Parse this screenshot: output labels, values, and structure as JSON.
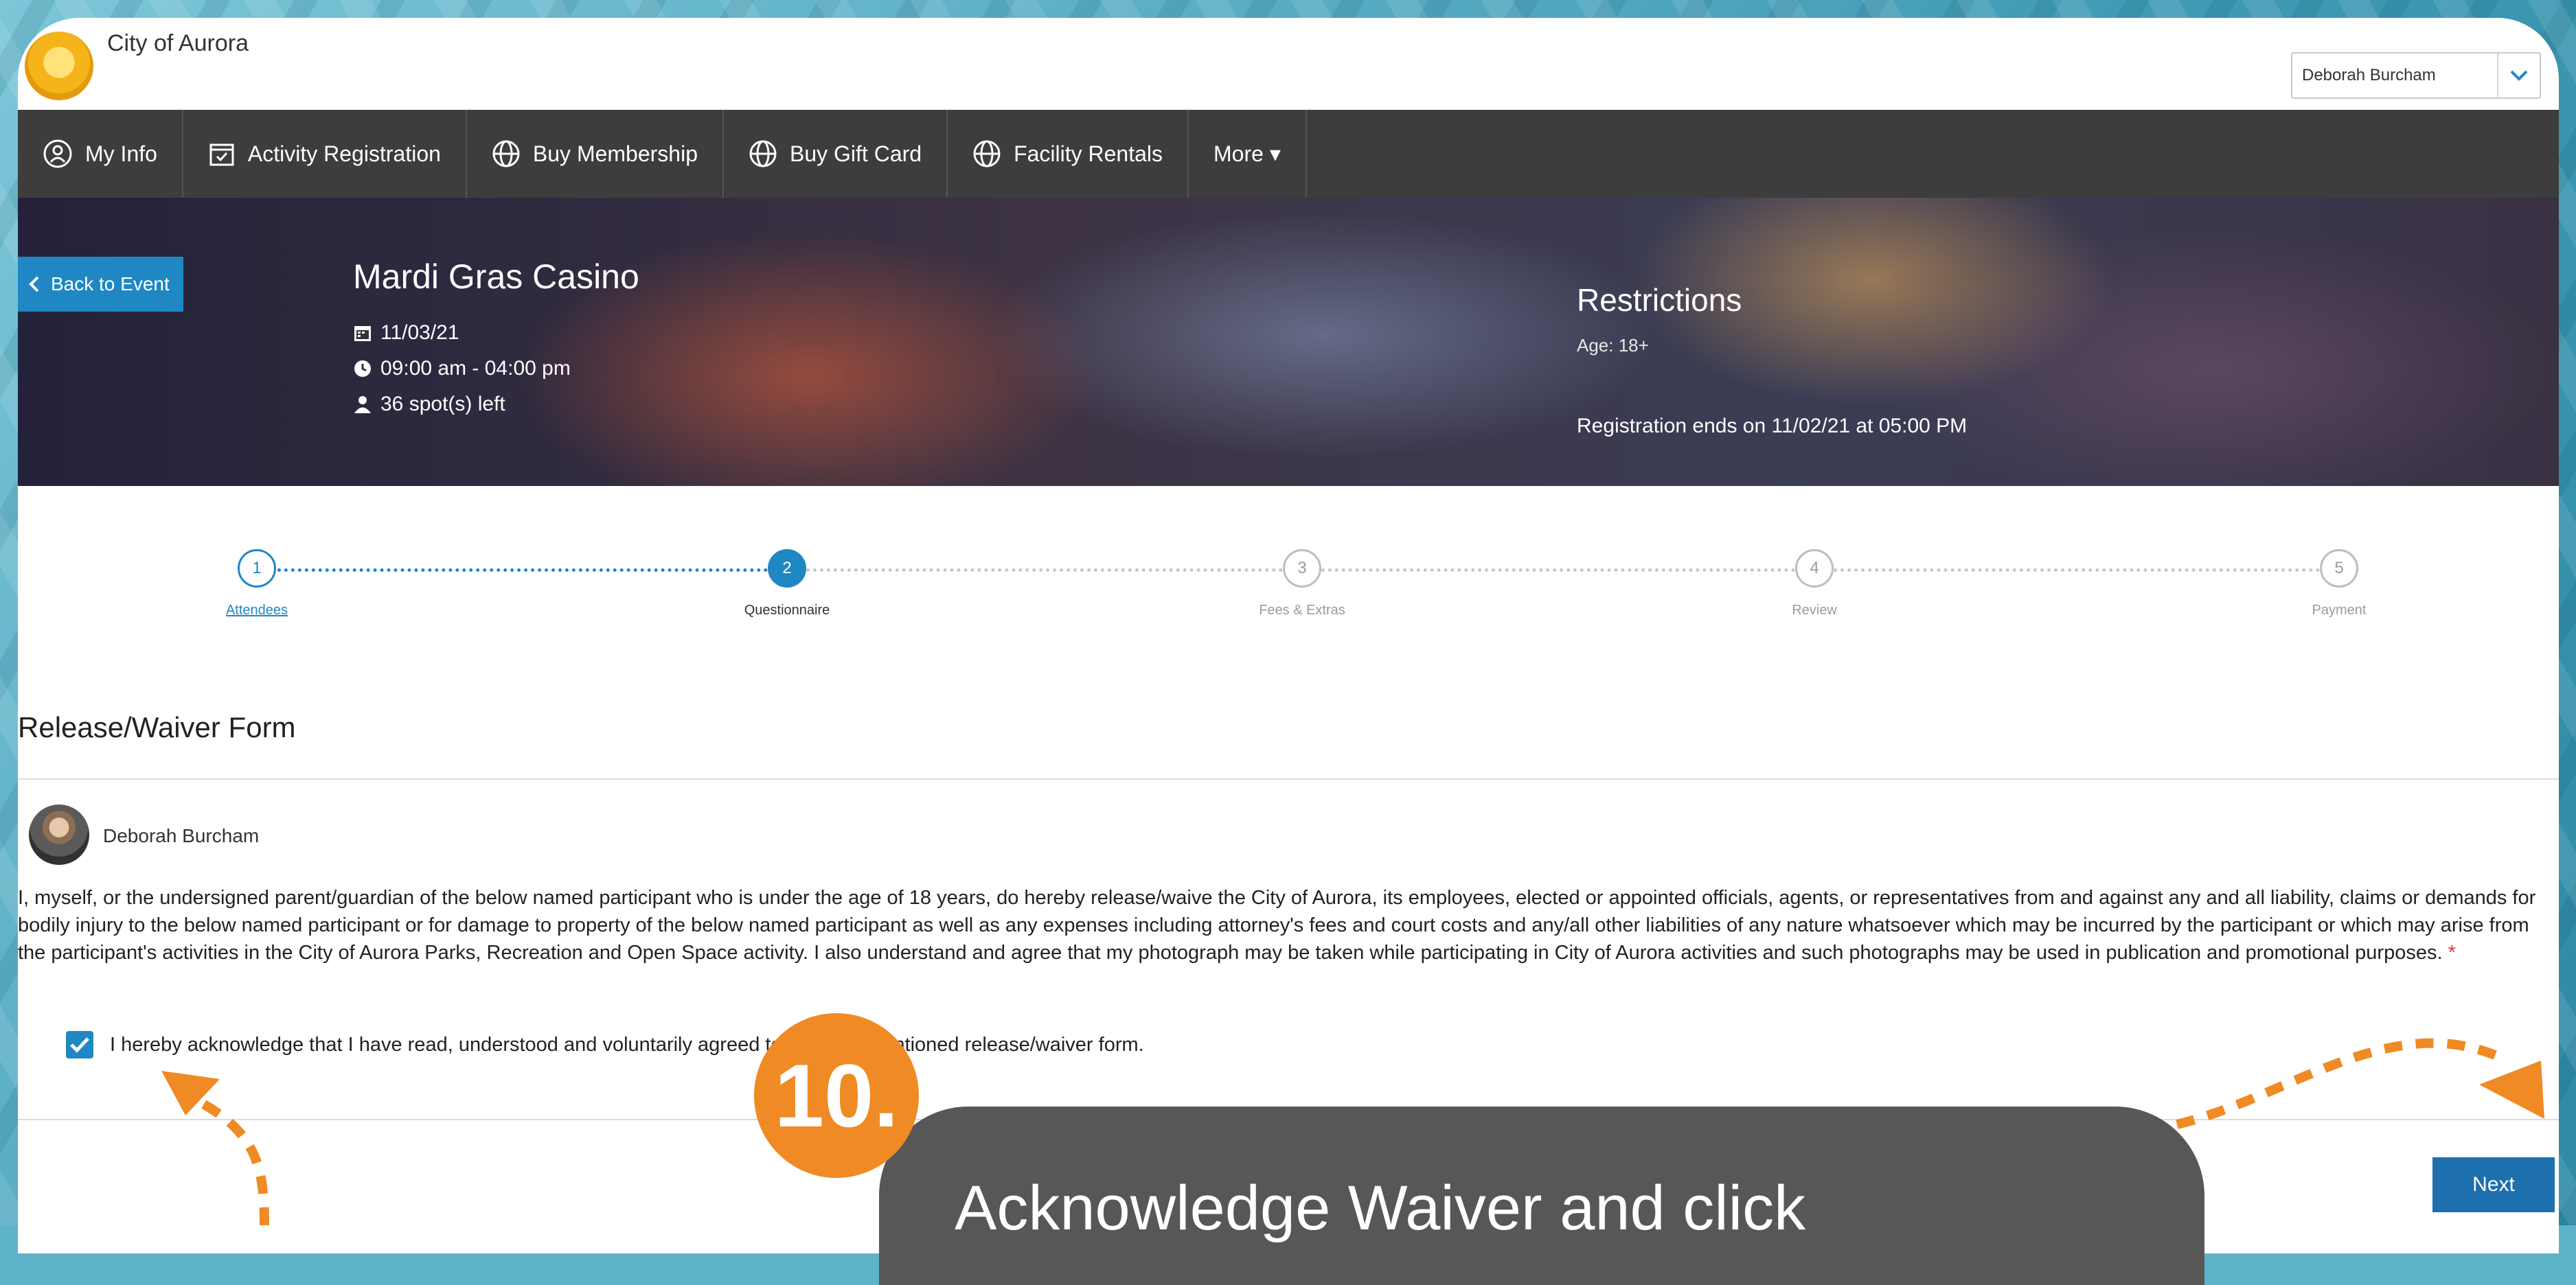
{
  "header": {
    "org_name": "City of Aurora",
    "user_name": "Deborah Burcham"
  },
  "nav": {
    "items": [
      {
        "label": "My Info",
        "icon": "user-circle-icon"
      },
      {
        "label": "Activity Registration",
        "icon": "calendar-check-icon"
      },
      {
        "label": "Buy Membership",
        "icon": "globe-icon"
      },
      {
        "label": "Buy Gift Card",
        "icon": "globe-icon"
      },
      {
        "label": "Facility Rentals",
        "icon": "globe-icon"
      },
      {
        "label": "More ▾",
        "icon": ""
      }
    ]
  },
  "event": {
    "back_label": "Back to Event",
    "title": "Mardi Gras Casino",
    "date": "11/03/21",
    "time": "09:00 am - 04:00 pm",
    "spots": "36 spot(s) left",
    "restrictions_title": "Restrictions",
    "age": "Age: 18+",
    "registration_ends": "Registration ends on 11/02/21 at 05:00 PM"
  },
  "steps": [
    {
      "number": "1",
      "label": "Attendees",
      "state": "done"
    },
    {
      "number": "2",
      "label": "Questionnaire",
      "state": "active"
    },
    {
      "number": "3",
      "label": "Fees & Extras",
      "state": "pending"
    },
    {
      "number": "4",
      "label": "Review",
      "state": "pending"
    },
    {
      "number": "5",
      "label": "Payment",
      "state": "pending"
    }
  ],
  "form": {
    "title": "Release/Waiver Form",
    "participant": "Deborah Burcham",
    "waiver_text": "I, myself, or the undersigned parent/guardian of the below named participant who is under the age of 18 years, do hereby release/waive the City of Aurora, its employees, elected or appointed officials, agents, or representatives from and against any and all liability, claims or demands for bodily injury to the below named participant or for damage to property of the below named participant as well as any expenses including attorney's fees and court costs and any/all other liabilities of any nature whatsoever which may be incurred by the participant or which may arise from the participant's activities in the City of Aurora Parks, Recreation and Open Space activity. I also understand and agree that my photograph may be taken while participating in City of Aurora activities and such photographs may be used in publication and promotional purposes.",
    "required_mark": "*",
    "ack_label": "I hereby acknowledge that I have read, understood and voluntarily agreed to the aforementioned release/waiver form.",
    "ack_checked": true,
    "next_label": "Next"
  },
  "tutorial": {
    "badge": "10.",
    "text": "Acknowledge Waiver and click"
  },
  "colors": {
    "accent": "#1f87c4",
    "nav_bg": "#3d3d3d",
    "badge": "#f08a24",
    "callout": "#575757"
  }
}
